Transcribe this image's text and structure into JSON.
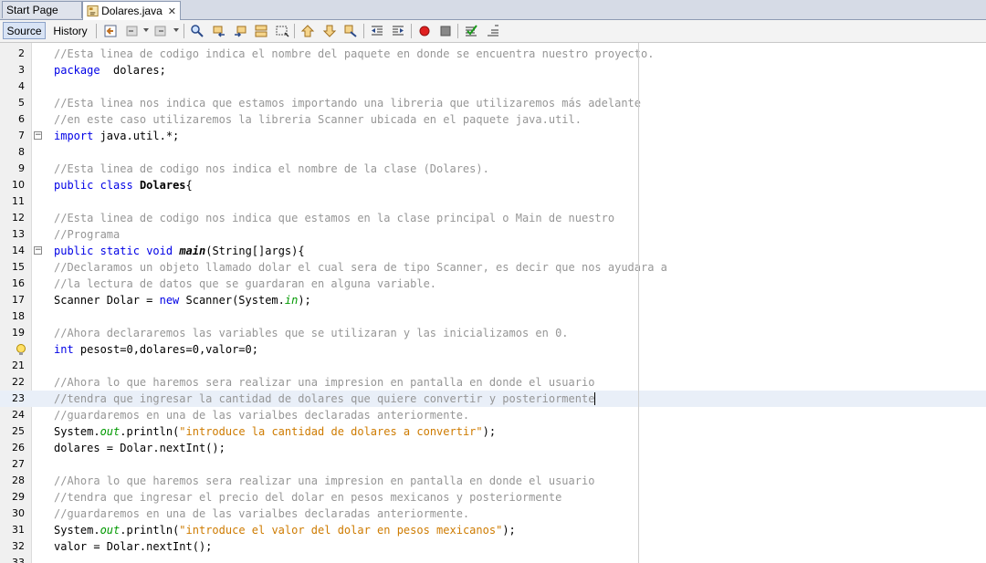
{
  "tabs": [
    {
      "label": "Start Page",
      "active": false
    },
    {
      "label": "Dolares.java",
      "active": true,
      "close": "✕"
    }
  ],
  "toolbar": {
    "source_label": "Source",
    "history_label": "History"
  },
  "editor": {
    "lines": [
      {
        "n": "2",
        "tokens": [
          [
            "cmt",
            "//Esta linea de codigo indica el nombre del paquete en donde se encuentra nuestro proyecto."
          ]
        ]
      },
      {
        "n": "3",
        "tokens": [
          [
            "kw",
            "package"
          ],
          [
            "",
            "  dolares;"
          ]
        ]
      },
      {
        "n": "4",
        "tokens": []
      },
      {
        "n": "5",
        "tokens": [
          [
            "cmt",
            "//Esta linea nos indica que estamos importando una libreria que utilizaremos más adelante"
          ]
        ]
      },
      {
        "n": "6",
        "tokens": [
          [
            "cmt",
            "//en este caso utilizaremos la libreria Scanner ubicada en el paquete java.util."
          ]
        ]
      },
      {
        "n": "7",
        "fold": "−",
        "tokens": [
          [
            "kw",
            "import"
          ],
          [
            "",
            " java.util.*;"
          ]
        ]
      },
      {
        "n": "8",
        "tokens": []
      },
      {
        "n": "9",
        "tokens": [
          [
            "cmt",
            "//Esta linea de codigo nos indica el nombre de la clase (Dolares)."
          ]
        ]
      },
      {
        "n": "10",
        "tokens": [
          [
            "kw",
            "public"
          ],
          [
            "",
            " "
          ],
          [
            "kw",
            "class"
          ],
          [
            "",
            " "
          ],
          [
            "cls",
            "Dolares"
          ],
          [
            "",
            "{"
          ]
        ]
      },
      {
        "n": "11",
        "tokens": []
      },
      {
        "n": "12",
        "tokens": [
          [
            "cmt",
            "//Esta linea de codigo nos indica que estamos en la clase principal o Main de nuestro"
          ]
        ]
      },
      {
        "n": "13",
        "tokens": [
          [
            "cmt",
            "//Programa"
          ]
        ]
      },
      {
        "n": "14",
        "fold": "−",
        "tokens": [
          [
            "kw",
            "public"
          ],
          [
            "",
            " "
          ],
          [
            "kw",
            "static"
          ],
          [
            "",
            " "
          ],
          [
            "kw",
            "void"
          ],
          [
            "",
            " "
          ],
          [
            "mth",
            "main"
          ],
          [
            "",
            "(String[]args){"
          ]
        ]
      },
      {
        "n": "15",
        "tokens": [
          [
            "cmt",
            "//Declaramos un objeto llamado dolar el cual sera de tipo Scanner, es decir que nos ayudara a"
          ]
        ]
      },
      {
        "n": "16",
        "tokens": [
          [
            "cmt",
            "//la lectura de datos que se guardaran en alguna variable."
          ]
        ]
      },
      {
        "n": "17",
        "tokens": [
          [
            "",
            "Scanner Dolar = "
          ],
          [
            "kw",
            "new"
          ],
          [
            "",
            " Scanner(System."
          ],
          [
            "fld",
            "in"
          ],
          [
            "",
            ");"
          ]
        ]
      },
      {
        "n": "18",
        "tokens": []
      },
      {
        "n": "19",
        "tokens": [
          [
            "cmt",
            "//Ahora declararemos las variables que se utilizaran y las inicializamos en 0."
          ]
        ]
      },
      {
        "n": "",
        "bulb": true,
        "tokens": [
          [
            "kw",
            "int"
          ],
          [
            "",
            " pesost=0,dolares=0,valor=0;"
          ]
        ]
      },
      {
        "n": "21",
        "tokens": []
      },
      {
        "n": "22",
        "tokens": [
          [
            "cmt",
            "//Ahora lo que haremos sera realizar una impresion en pantalla en donde el usuario"
          ]
        ]
      },
      {
        "n": "23",
        "current": true,
        "tokens": [
          [
            "cmt",
            "//tendra que ingresar la cantidad de dolares que quiere convertir y posteriormente"
          ]
        ]
      },
      {
        "n": "24",
        "tokens": [
          [
            "cmt",
            "//guardaremos en una de las varialbes declaradas anteriormente."
          ]
        ]
      },
      {
        "n": "25",
        "tokens": [
          [
            "",
            "System."
          ],
          [
            "fld",
            "out"
          ],
          [
            "",
            ".println("
          ],
          [
            "str",
            "\"introduce la cantidad de dolares a convertir\""
          ],
          [
            "",
            ");"
          ]
        ]
      },
      {
        "n": "26",
        "tokens": [
          [
            "",
            "dolares = Dolar.nextInt();"
          ]
        ]
      },
      {
        "n": "27",
        "tokens": []
      },
      {
        "n": "28",
        "tokens": [
          [
            "cmt",
            "//Ahora lo que haremos sera realizar una impresion en pantalla en donde el usuario"
          ]
        ]
      },
      {
        "n": "29",
        "tokens": [
          [
            "cmt",
            "//tendra que ingresar el precio del dolar en pesos mexicanos y posteriormente"
          ]
        ]
      },
      {
        "n": "30",
        "tokens": [
          [
            "cmt",
            "//guardaremos en una de las varialbes declaradas anteriormente."
          ]
        ]
      },
      {
        "n": "31",
        "tokens": [
          [
            "",
            "System."
          ],
          [
            "fld",
            "out"
          ],
          [
            "",
            ".println("
          ],
          [
            "str",
            "\"introduce el valor del dolar en pesos mexicanos\""
          ],
          [
            "",
            ");"
          ]
        ]
      },
      {
        "n": "32",
        "tokens": [
          [
            "",
            "valor = Dolar.nextInt();"
          ]
        ]
      },
      {
        "n": "33",
        "tokens": []
      }
    ]
  }
}
